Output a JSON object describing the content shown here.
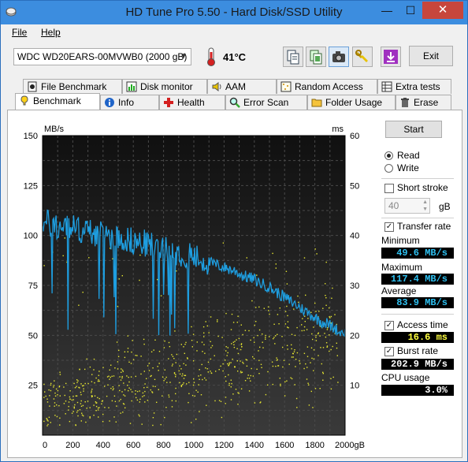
{
  "window": {
    "title": "HD Tune Pro 5.50 - Hard Disk/SSD Utility",
    "minimize": "—",
    "maximize": "☐",
    "close": "✕"
  },
  "menu": {
    "file": "File",
    "help": "Help"
  },
  "toolbar": {
    "drive": "WDC WD20EARS-00MVWB0 (2000 gB)",
    "temperature": "41°C",
    "exit_label": "Exit"
  },
  "tabs_top": [
    {
      "label": "File Benchmark",
      "icon": "file-benchmark-icon"
    },
    {
      "label": "Disk monitor",
      "icon": "disk-monitor-icon"
    },
    {
      "label": "AAM",
      "icon": "speaker-icon"
    },
    {
      "label": "Random Access",
      "icon": "random-access-icon"
    },
    {
      "label": "Extra tests",
      "icon": "extra-tests-icon"
    }
  ],
  "tabs_bottom": [
    {
      "label": "Benchmark",
      "icon": "benchmark-icon"
    },
    {
      "label": "Info",
      "icon": "info-icon"
    },
    {
      "label": "Health",
      "icon": "health-icon"
    },
    {
      "label": "Error Scan",
      "icon": "error-scan-icon"
    },
    {
      "label": "Folder Usage",
      "icon": "folder-icon"
    },
    {
      "label": "Erase",
      "icon": "trash-icon"
    }
  ],
  "controls": {
    "start_label": "Start",
    "read_label": "Read",
    "write_label": "Write",
    "read_selected": true,
    "short_stroke_label": "Short stroke",
    "short_stroke_checked": false,
    "short_stroke_value": "40",
    "short_stroke_unit": "gB",
    "transfer_rate_label": "Transfer rate",
    "transfer_rate_checked": true,
    "minimum_label": "Minimum",
    "minimum_value": "49.6 MB/s",
    "maximum_label": "Maximum",
    "maximum_value": "117.4 MB/s",
    "average_label": "Average",
    "average_value": "83.9 MB/s",
    "access_time_label": "Access time",
    "access_time_checked": true,
    "access_time_value": "16.6 ms",
    "burst_rate_label": "Burst rate",
    "burst_rate_checked": true,
    "burst_rate_value": "202.9 MB/s",
    "cpu_usage_label": "CPU usage",
    "cpu_usage_value": "3.0%"
  },
  "chart_data": {
    "type": "line",
    "ylabel_left": "MB/s",
    "ylabel_right": "ms",
    "xlabel_unit": "gB",
    "xlim": [
      0,
      2000
    ],
    "ylim_left": [
      0,
      150
    ],
    "ylim_right": [
      0,
      60
    ],
    "x_ticks": [
      "0",
      "200",
      "400",
      "600",
      "800",
      "1000",
      "1200",
      "1400",
      "1600",
      "1800",
      "2000gB"
    ],
    "y_ticks_left": [
      "150",
      "125",
      "100",
      "75",
      "50",
      "25"
    ],
    "y_ticks_right": [
      "60",
      "50",
      "40",
      "30",
      "20",
      "10"
    ],
    "grid": true,
    "series": [
      {
        "name": "Transfer rate",
        "color": "#1e9ee0",
        "x": [
          0,
          20,
          40,
          60,
          80,
          100,
          120,
          140,
          160,
          180,
          200,
          240,
          280,
          320,
          360,
          400,
          440,
          480,
          520,
          560,
          600,
          640,
          680,
          720,
          760,
          800,
          840,
          880,
          920,
          960,
          1000,
          1040,
          1080,
          1120,
          1160,
          1200,
          1240,
          1280,
          1320,
          1360,
          1400,
          1440,
          1480,
          1520,
          1560,
          1600,
          1640,
          1680,
          1720,
          1760,
          1800,
          1840,
          1880,
          1920,
          1960,
          2000
        ],
        "y": [
          108,
          105,
          107,
          104,
          106,
          103,
          104,
          106,
          103,
          105,
          104,
          103,
          102,
          102,
          101,
          100,
          100,
          99,
          99,
          98,
          97,
          96,
          96,
          95,
          94,
          93,
          92,
          92,
          91,
          90,
          89,
          88,
          87,
          86,
          85,
          84,
          83,
          82,
          80,
          79,
          78,
          76,
          75,
          73,
          71,
          69,
          67,
          65,
          63,
          61,
          59,
          57,
          56,
          54,
          52,
          51
        ]
      },
      {
        "name": "Access time",
        "color": "#e8e830",
        "axis": "right",
        "typical": 16.6,
        "range": [
          2,
          40
        ]
      }
    ]
  }
}
